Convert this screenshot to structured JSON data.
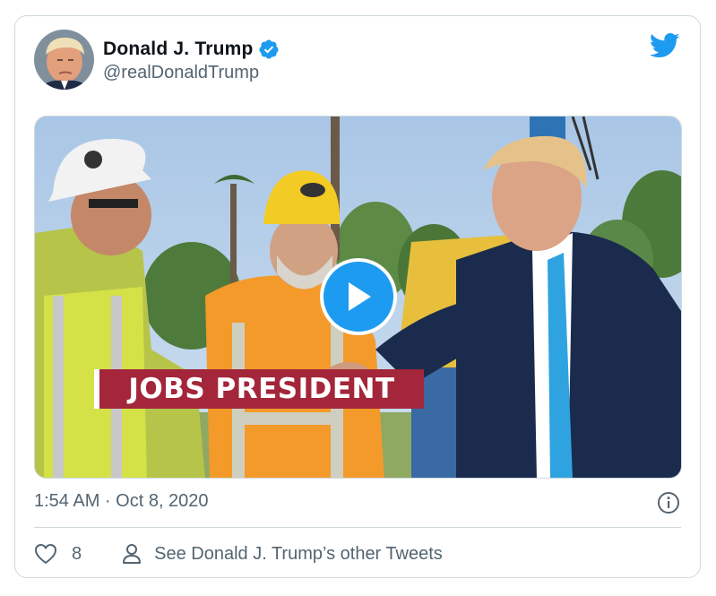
{
  "tweet": {
    "author_name": "Donald J. Trump",
    "handle": "@realDonaldTrump",
    "timestamp": "1:54 AM · Oct 8, 2020",
    "like_count": "8",
    "see_other_tweets": "See Donald J. Trump’s other Tweets"
  },
  "media": {
    "banner_text": "JOBS PRESIDENT"
  },
  "icons": {
    "verified": "verified-badge-icon",
    "brand": "twitter-bird-icon",
    "play": "play-icon",
    "info": "info-icon",
    "like": "heart-icon",
    "profile": "person-icon"
  },
  "colors": {
    "accent": "#1d9bf0",
    "text_primary": "#0f1419",
    "text_secondary": "#536471",
    "border": "#cfd9de",
    "banner": "#a3263a"
  }
}
